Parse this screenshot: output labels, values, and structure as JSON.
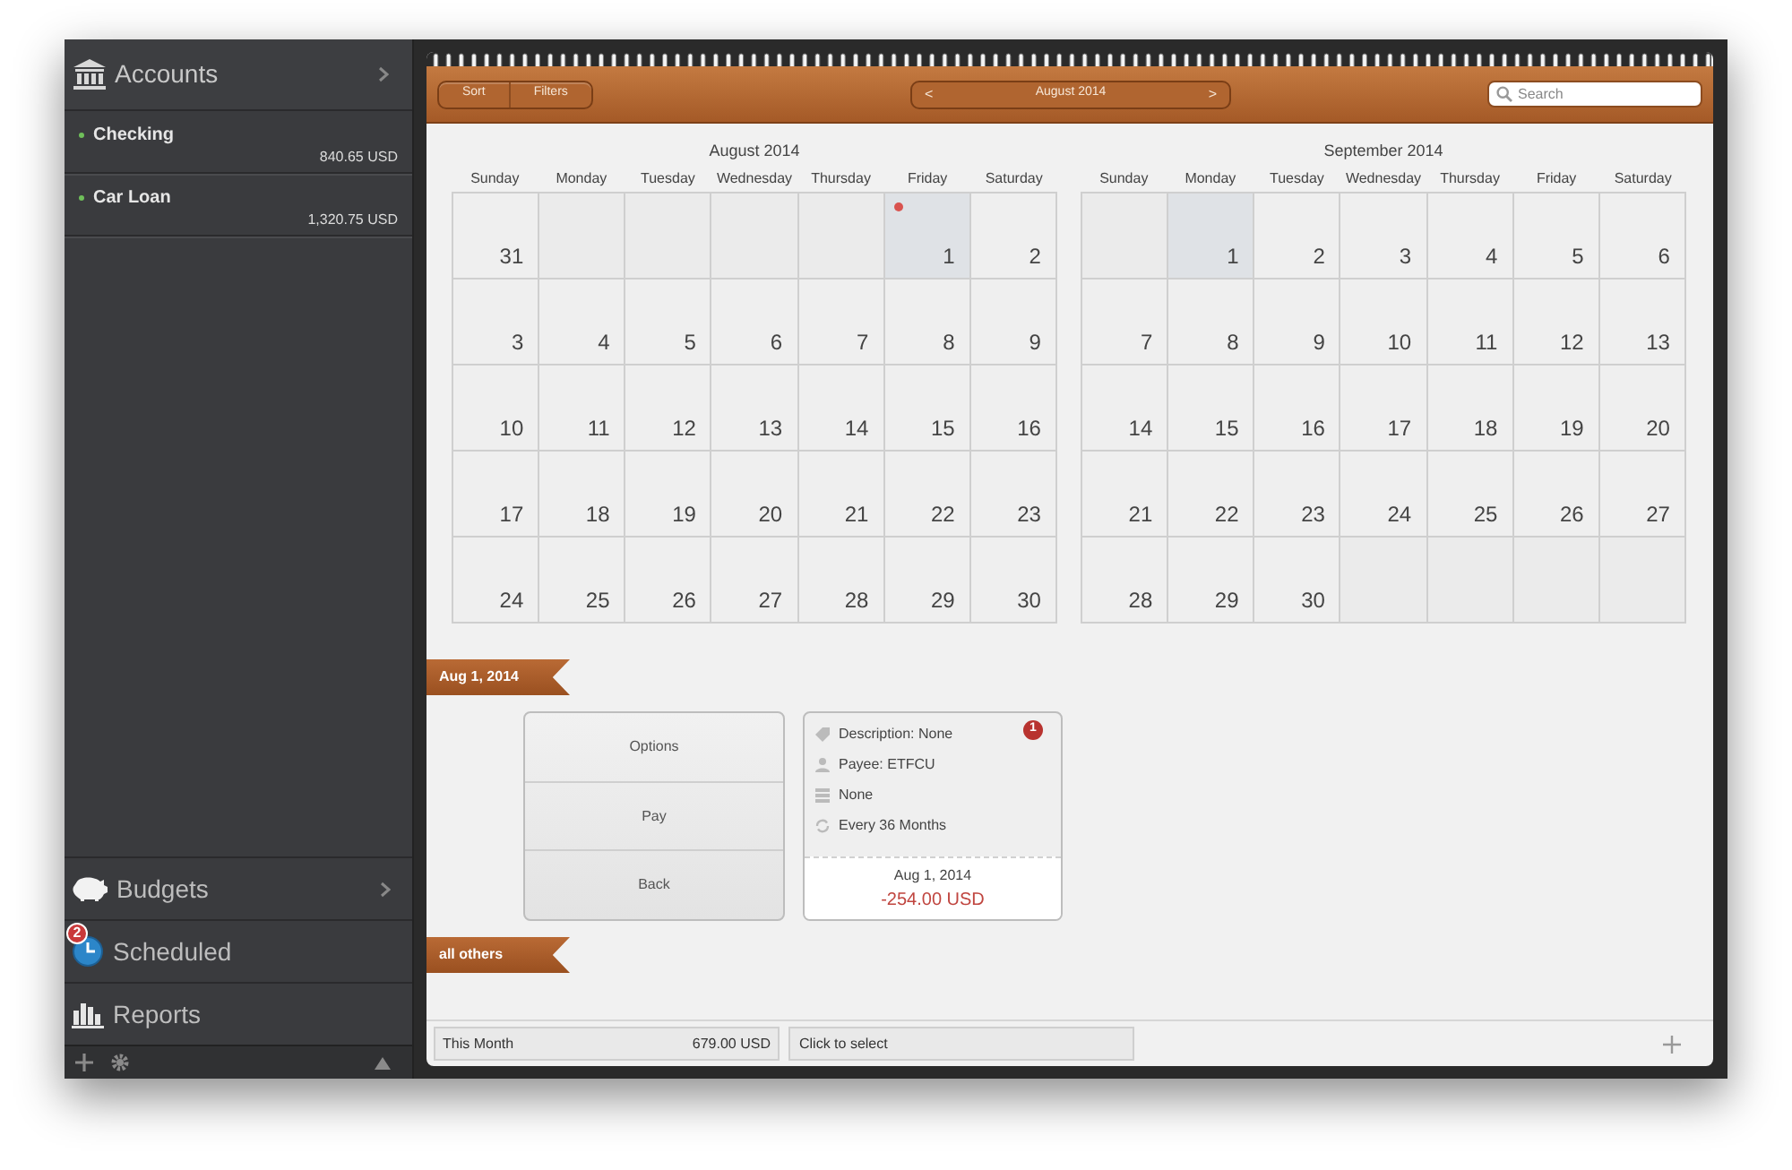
{
  "sidebar": {
    "header": {
      "title": "Accounts"
    },
    "accounts": [
      {
        "name": "Checking",
        "balance": "840.65 USD"
      },
      {
        "name": "Car Loan",
        "balance": "1,320.75 USD"
      }
    ],
    "sections": [
      {
        "kind": "budgets",
        "label": "Budgets"
      },
      {
        "kind": "scheduled",
        "label": "Scheduled",
        "badge": "2"
      },
      {
        "kind": "reports",
        "label": "Reports"
      }
    ]
  },
  "toolbar": {
    "buttons": [
      "Sort",
      "Filters"
    ],
    "month": {
      "prev": "<",
      "label": "August 2014",
      "next": ">"
    },
    "search": {
      "placeholder": "Search"
    }
  },
  "months": [
    {
      "title": "August  2014",
      "weekdays": [
        "Sunday",
        "Monday",
        "Tuesday",
        "Wednesday",
        "Thursday",
        "Friday",
        "Saturday"
      ],
      "weeks": [
        [
          {
            "kind": "day",
            "day": "31",
            "selected": false,
            "has_event": false
          },
          {
            "kind": "blank"
          },
          {
            "kind": "blank"
          },
          {
            "kind": "blank"
          },
          {
            "kind": "blank"
          },
          {
            "kind": "day",
            "day": "1",
            "selected": true,
            "has_event": true
          },
          {
            "kind": "day",
            "day": "2",
            "selected": false,
            "has_event": false
          }
        ],
        [
          {
            "kind": "day",
            "day": "3",
            "selected": false,
            "has_event": false
          },
          {
            "kind": "day",
            "day": "4",
            "selected": false,
            "has_event": false
          },
          {
            "kind": "day",
            "day": "5",
            "selected": false,
            "has_event": false
          },
          {
            "kind": "day",
            "day": "6",
            "selected": false,
            "has_event": false
          },
          {
            "kind": "day",
            "day": "7",
            "selected": false,
            "has_event": false
          },
          {
            "kind": "day",
            "day": "8",
            "selected": false,
            "has_event": false
          },
          {
            "kind": "day",
            "day": "9",
            "selected": false,
            "has_event": false
          }
        ],
        [
          {
            "kind": "day",
            "day": "10",
            "selected": false,
            "has_event": false
          },
          {
            "kind": "day",
            "day": "11",
            "selected": false,
            "has_event": false
          },
          {
            "kind": "day",
            "day": "12",
            "selected": false,
            "has_event": false
          },
          {
            "kind": "day",
            "day": "13",
            "selected": false,
            "has_event": false
          },
          {
            "kind": "day",
            "day": "14",
            "selected": false,
            "has_event": false
          },
          {
            "kind": "day",
            "day": "15",
            "selected": false,
            "has_event": false
          },
          {
            "kind": "day",
            "day": "16",
            "selected": false,
            "has_event": false
          }
        ],
        [
          {
            "kind": "day",
            "day": "17",
            "selected": false,
            "has_event": false
          },
          {
            "kind": "day",
            "day": "18",
            "selected": false,
            "has_event": false
          },
          {
            "kind": "day",
            "day": "19",
            "selected": false,
            "has_event": false
          },
          {
            "kind": "day",
            "day": "20",
            "selected": false,
            "has_event": false
          },
          {
            "kind": "day",
            "day": "21",
            "selected": false,
            "has_event": false
          },
          {
            "kind": "day",
            "day": "22",
            "selected": false,
            "has_event": false
          },
          {
            "kind": "day",
            "day": "23",
            "selected": false,
            "has_event": false
          }
        ],
        [
          {
            "kind": "day",
            "day": "24",
            "selected": false,
            "has_event": false
          },
          {
            "kind": "day",
            "day": "25",
            "selected": false,
            "has_event": false
          },
          {
            "kind": "day",
            "day": "26",
            "selected": false,
            "has_event": false
          },
          {
            "kind": "day",
            "day": "27",
            "selected": false,
            "has_event": false
          },
          {
            "kind": "day",
            "day": "28",
            "selected": false,
            "has_event": false
          },
          {
            "kind": "day",
            "day": "29",
            "selected": false,
            "has_event": false
          },
          {
            "kind": "day",
            "day": "30",
            "selected": false,
            "has_event": false
          }
        ]
      ]
    },
    {
      "title": "September  2014",
      "weekdays": [
        "Sunday",
        "Monday",
        "Tuesday",
        "Wednesday",
        "Thursday",
        "Friday",
        "Saturday"
      ],
      "weeks": [
        [
          {
            "kind": "blank"
          },
          {
            "kind": "day",
            "day": "1",
            "selected": true,
            "has_event": false
          },
          {
            "kind": "day",
            "day": "2",
            "selected": false,
            "has_event": false
          },
          {
            "kind": "day",
            "day": "3",
            "selected": false,
            "has_event": false
          },
          {
            "kind": "day",
            "day": "4",
            "selected": false,
            "has_event": false
          },
          {
            "kind": "day",
            "day": "5",
            "selected": false,
            "has_event": false
          },
          {
            "kind": "day",
            "day": "6",
            "selected": false,
            "has_event": false
          }
        ],
        [
          {
            "kind": "day",
            "day": "7",
            "selected": false,
            "has_event": false
          },
          {
            "kind": "day",
            "day": "8",
            "selected": false,
            "has_event": false
          },
          {
            "kind": "day",
            "day": "9",
            "selected": false,
            "has_event": false
          },
          {
            "kind": "day",
            "day": "10",
            "selected": false,
            "has_event": false
          },
          {
            "kind": "day",
            "day": "11",
            "selected": false,
            "has_event": false
          },
          {
            "kind": "day",
            "day": "12",
            "selected": false,
            "has_event": false
          },
          {
            "kind": "day",
            "day": "13",
            "selected": false,
            "has_event": false
          }
        ],
        [
          {
            "kind": "day",
            "day": "14",
            "selected": false,
            "has_event": false
          },
          {
            "kind": "day",
            "day": "15",
            "selected": false,
            "has_event": false
          },
          {
            "kind": "day",
            "day": "16",
            "selected": false,
            "has_event": false
          },
          {
            "kind": "day",
            "day": "17",
            "selected": false,
            "has_event": false
          },
          {
            "kind": "day",
            "day": "18",
            "selected": false,
            "has_event": false
          },
          {
            "kind": "day",
            "day": "19",
            "selected": false,
            "has_event": false
          },
          {
            "kind": "day",
            "day": "20",
            "selected": false,
            "has_event": false
          }
        ],
        [
          {
            "kind": "day",
            "day": "21",
            "selected": false,
            "has_event": false
          },
          {
            "kind": "day",
            "day": "22",
            "selected": false,
            "has_event": false
          },
          {
            "kind": "day",
            "day": "23",
            "selected": false,
            "has_event": false
          },
          {
            "kind": "day",
            "day": "24",
            "selected": false,
            "has_event": false
          },
          {
            "kind": "day",
            "day": "25",
            "selected": false,
            "has_event": false
          },
          {
            "kind": "day",
            "day": "26",
            "selected": false,
            "has_event": false
          },
          {
            "kind": "day",
            "day": "27",
            "selected": false,
            "has_event": false
          }
        ],
        [
          {
            "kind": "day",
            "day": "28",
            "selected": false,
            "has_event": false
          },
          {
            "kind": "day",
            "day": "29",
            "selected": false,
            "has_event": false
          },
          {
            "kind": "day",
            "day": "30",
            "selected": false,
            "has_event": false
          },
          {
            "kind": "blank"
          },
          {
            "kind": "blank"
          },
          {
            "kind": "blank"
          },
          {
            "kind": "blank"
          }
        ]
      ]
    }
  ],
  "groups": [
    {
      "ribbon": "Aug 1, 2014",
      "actions": [
        "Options",
        "Pay",
        "Back"
      ],
      "transaction": {
        "badge": "1",
        "details": [
          {
            "kind": "tag",
            "text": "Description: None"
          },
          {
            "kind": "person",
            "text": "Payee: ETFCU"
          },
          {
            "kind": "category",
            "text": "None"
          },
          {
            "kind": "repeat",
            "text": "Every 36 Months"
          }
        ],
        "date": "Aug 1, 2014",
        "amount": "-254.00 USD"
      }
    },
    {
      "ribbon": "all others"
    }
  ],
  "status_bar": {
    "period": "This Month",
    "total": "679.00 USD",
    "selector": "Click to select"
  }
}
